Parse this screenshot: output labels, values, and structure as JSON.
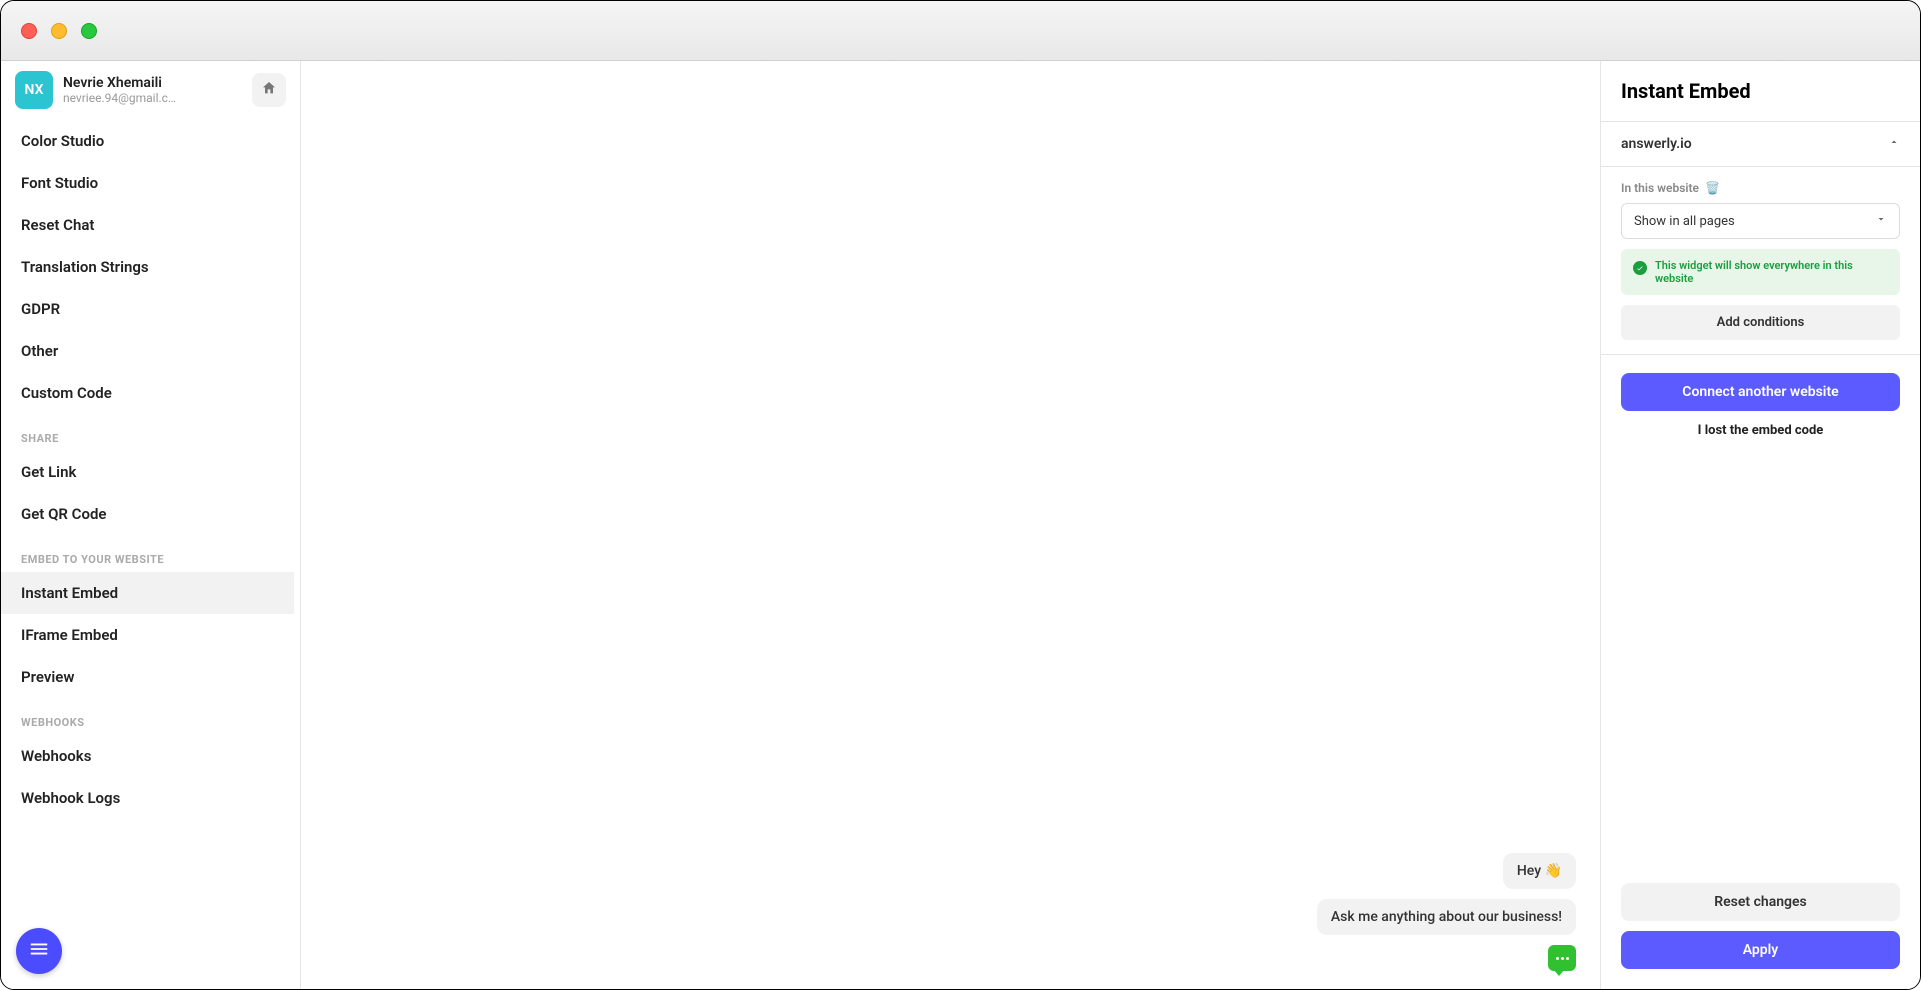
{
  "user": {
    "initials": "NX",
    "name": "Nevrie Xhemaili",
    "email": "nevriee.94@gmail.c…"
  },
  "sidebar": {
    "items": [
      {
        "label": "Color Studio",
        "active": false
      },
      {
        "label": "Font Studio",
        "active": false
      },
      {
        "label": "Reset Chat",
        "active": false
      },
      {
        "label": "Translation Strings",
        "active": false
      },
      {
        "label": "GDPR",
        "active": false
      },
      {
        "label": "Other",
        "active": false
      },
      {
        "label": "Custom Code",
        "active": false
      }
    ],
    "section_share": "Share",
    "share_items": [
      {
        "label": "Get Link"
      },
      {
        "label": "Get QR Code"
      }
    ],
    "section_embed": "Embed to your website",
    "embed_items": [
      {
        "label": "Instant Embed",
        "active": true
      },
      {
        "label": "IFrame Embed",
        "active": false
      },
      {
        "label": "Preview",
        "active": false
      }
    ],
    "section_webhooks": "Webhooks",
    "webhook_items": [
      {
        "label": "Webhooks"
      },
      {
        "label": "Webhook Logs"
      }
    ]
  },
  "chat": {
    "bubble1": "Hey 👋",
    "bubble2": "Ask me anything about our business!"
  },
  "panel": {
    "title": "Instant Embed",
    "site": "answerly.io",
    "in_this_website": "In this website",
    "trash_icon": "🗑️",
    "select_value": "Show in all pages",
    "info": "This widget will show everywhere in this website",
    "add_conditions": "Add conditions",
    "connect_another": "Connect another website",
    "lost_code": "I lost the embed code",
    "reset": "Reset changes",
    "apply": "Apply"
  }
}
